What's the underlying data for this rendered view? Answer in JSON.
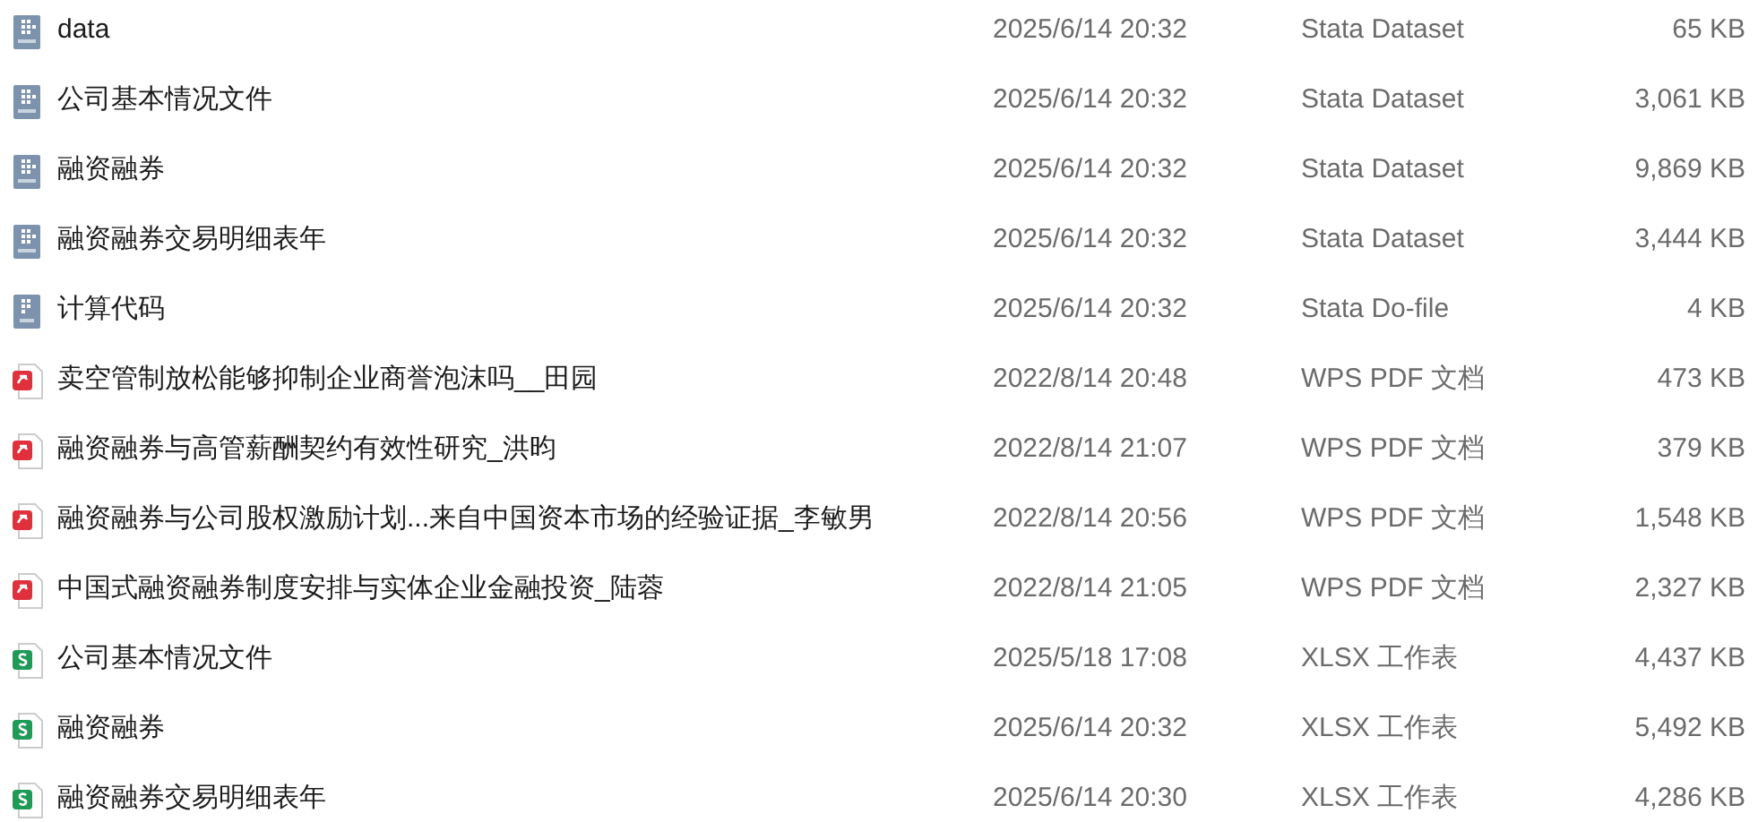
{
  "files": [
    {
      "kind": "dta",
      "name": "data",
      "modified": "2025/6/14 20:32",
      "type": "Stata Dataset",
      "size": "65 KB"
    },
    {
      "kind": "dta",
      "name": "公司基本情况文件",
      "modified": "2025/6/14 20:32",
      "type": "Stata Dataset",
      "size": "3,061 KB"
    },
    {
      "kind": "dta",
      "name": "融资融券",
      "modified": "2025/6/14 20:32",
      "type": "Stata Dataset",
      "size": "9,869 KB"
    },
    {
      "kind": "dta",
      "name": "融资融券交易明细表年",
      "modified": "2025/6/14 20:32",
      "type": "Stata Dataset",
      "size": "3,444 KB"
    },
    {
      "kind": "do",
      "name": "计算代码",
      "modified": "2025/6/14 20:32",
      "type": "Stata Do-file",
      "size": "4 KB"
    },
    {
      "kind": "pdf",
      "name": "卖空管制放松能够抑制企业商誉泡沫吗__田园",
      "modified": "2022/8/14 20:48",
      "type": "WPS PDF 文档",
      "size": "473 KB"
    },
    {
      "kind": "pdf",
      "name": "融资融券与高管薪酬契约有效性研究_洪昀",
      "modified": "2022/8/14 21:07",
      "type": "WPS PDF 文档",
      "size": "379 KB"
    },
    {
      "kind": "pdf",
      "name": "融资融券与公司股权激励计划...来自中国资本市场的经验证据_李敏男",
      "modified": "2022/8/14 20:56",
      "type": "WPS PDF 文档",
      "size": "1,548 KB"
    },
    {
      "kind": "pdf",
      "name": "中国式融资融券制度安排与实体企业金融投资_陆蓉",
      "modified": "2022/8/14 21:05",
      "type": "WPS PDF 文档",
      "size": "2,327 KB"
    },
    {
      "kind": "xlsx",
      "name": "公司基本情况文件",
      "modified": "2025/5/18 17:08",
      "type": "XLSX 工作表",
      "size": "4,437 KB"
    },
    {
      "kind": "xlsx",
      "name": "融资融券",
      "modified": "2025/6/14 20:32",
      "type": "XLSX 工作表",
      "size": "5,492 KB"
    },
    {
      "kind": "xlsx",
      "name": "融资融券交易明细表年",
      "modified": "2025/6/14 20:30",
      "type": "XLSX 工作表",
      "size": "4,286 KB"
    }
  ]
}
